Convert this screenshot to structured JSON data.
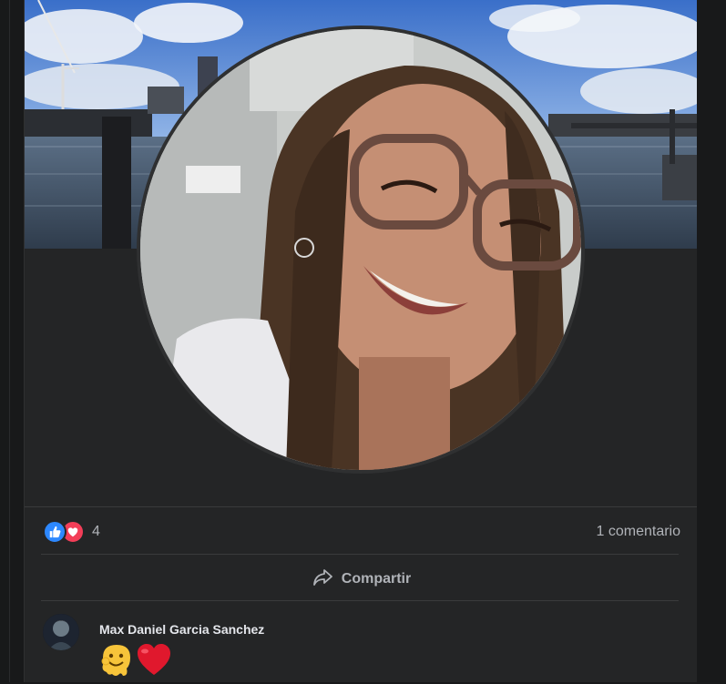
{
  "post": {
    "reactions": {
      "count": "4",
      "types": [
        "like",
        "love"
      ]
    },
    "comments_summary": "1 comentario",
    "actions": {
      "share_label": "Compartir"
    },
    "comments": [
      {
        "author": "Max Daniel Garcia Sanchez",
        "content_emojis": [
          "melting-face",
          "red-heart"
        ]
      }
    ]
  },
  "colors": {
    "background": "#18191a",
    "card": "#242526",
    "divider": "#3a3b3c",
    "text_primary": "#e4e6eb",
    "text_secondary": "#b0b3b8",
    "like_blue": "#2d88ff",
    "love_red": "#f33e58"
  },
  "icons": {
    "like": "thumbs-up-icon",
    "love": "heart-icon",
    "share": "share-arrow-icon"
  }
}
